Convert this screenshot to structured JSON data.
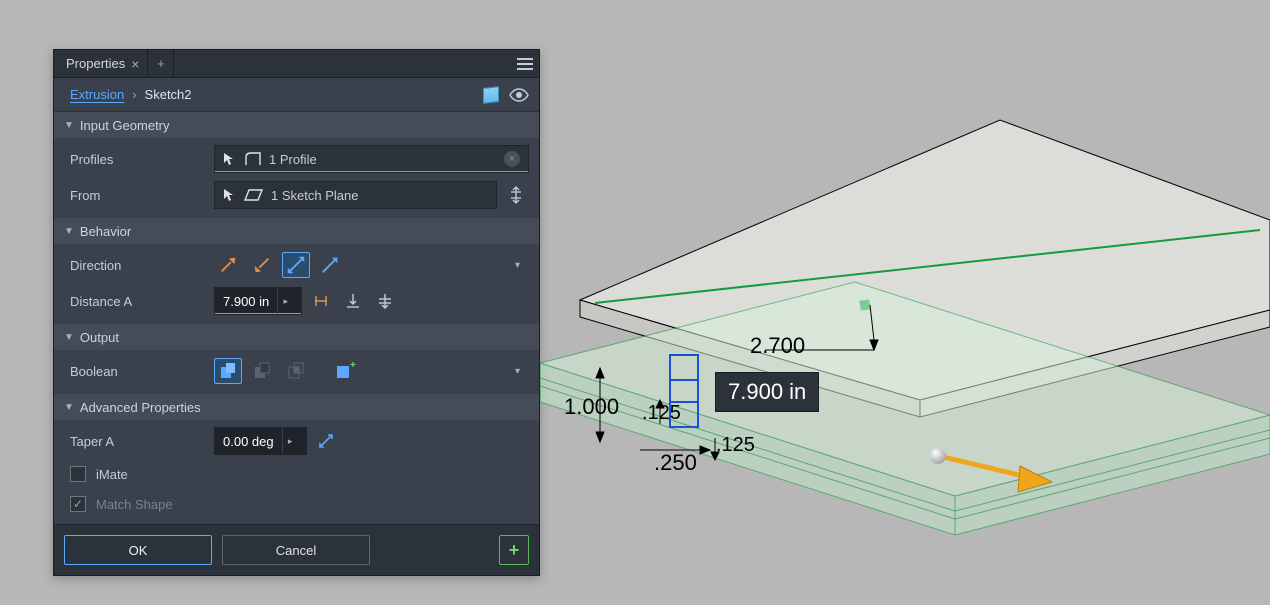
{
  "panel": {
    "tab_title": "Properties",
    "crumb_link": "Extrusion",
    "crumb_leaf": "Sketch2",
    "sections": {
      "input_geometry": "Input Geometry",
      "behavior": "Behavior",
      "output": "Output",
      "advanced": "Advanced Properties"
    },
    "rows": {
      "profiles_label": "Profiles",
      "profiles_value": "1 Profile",
      "from_label": "From",
      "from_value": "1 Sketch Plane",
      "direction_label": "Direction",
      "distance_a_label": "Distance A",
      "distance_a_value": "7.900 in",
      "boolean_label": "Boolean",
      "taper_label": "Taper A",
      "taper_value": "0.00 deg",
      "imate_label": "iMate",
      "match_shape_label": "Match Shape"
    },
    "footer": {
      "ok": "OK",
      "cancel": "Cancel"
    }
  },
  "viewport": {
    "badge": "7.900 in",
    "dims": {
      "top_right": "2.700",
      "left": "1.000",
      "mid_upper": ".125",
      "under_mid": ".125",
      "bottom": ".250"
    }
  }
}
